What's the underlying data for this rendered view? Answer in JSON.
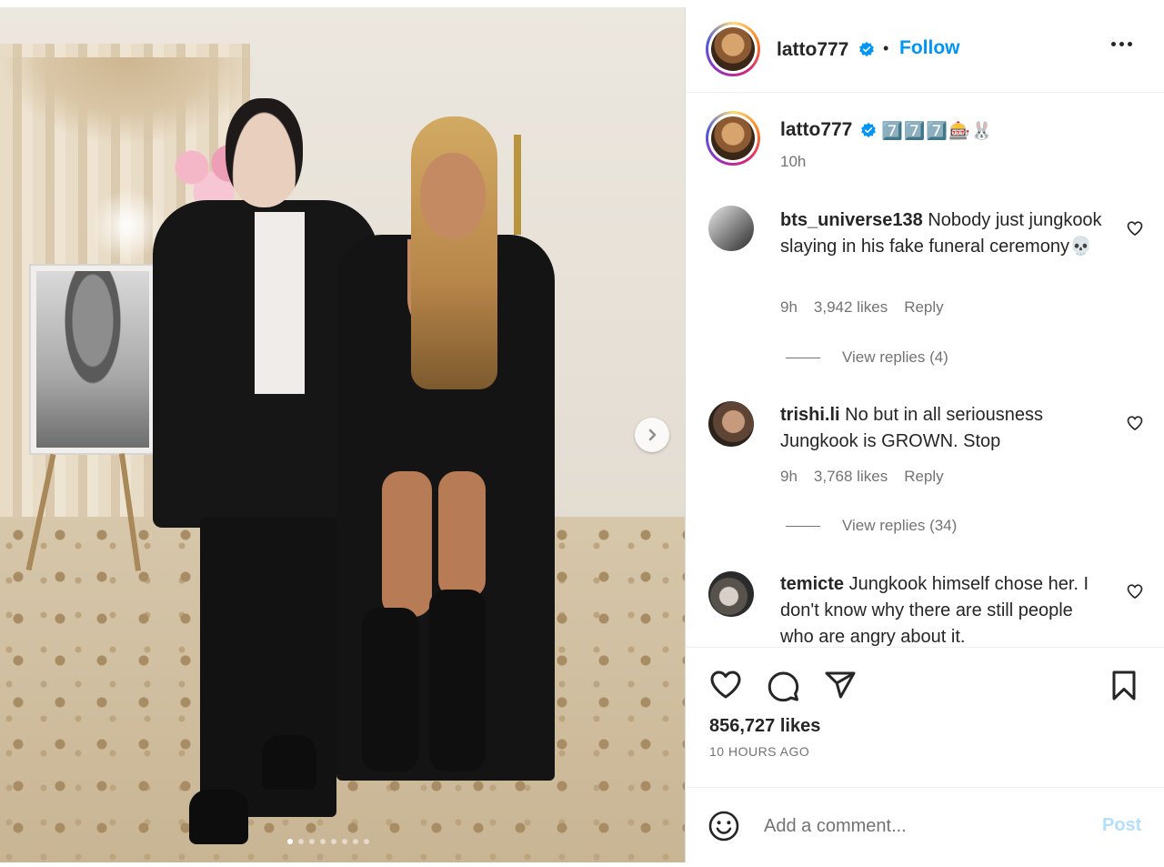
{
  "post": {
    "username": "latto777",
    "follow_separator": "•",
    "follow_label": "Follow",
    "caption": {
      "username": "latto777",
      "text": "7️⃣7️⃣7️⃣🎰🐰",
      "time": "10h"
    },
    "carousel": {
      "slides": 8,
      "active_index": 0
    }
  },
  "comments": [
    {
      "username": "bts_universe138",
      "text": "Nobody just jungkook slaying in his fake funeral ceremony💀",
      "time": "9h",
      "likes": "3,942 likes",
      "reply_label": "Reply",
      "view_replies": "View replies (4)"
    },
    {
      "username": "trishi.li",
      "text": "No but in all seriousness Jungkook is GROWN. Stop",
      "time": "9h",
      "likes": "3,768 likes",
      "reply_label": "Reply",
      "view_replies": "View replies (34)"
    },
    {
      "username": "temicte",
      "text": "Jungkook himself chose her. I don't know why there are still people who are angry about it.",
      "time": "",
      "likes": "",
      "reply_label": "",
      "view_replies": ""
    }
  ],
  "engagement": {
    "likes": "856,727 likes",
    "time_ago": "10 HOURS AGO"
  },
  "comment_box": {
    "placeholder": "Add a comment...",
    "post_label": "Post"
  },
  "icons": {
    "verified": "verified-badge-icon",
    "more": "more-options-icon",
    "like": "heart-icon",
    "comment": "comment-bubble-icon",
    "share": "paper-plane-icon",
    "save": "bookmark-icon",
    "emoji": "smiley-icon",
    "next": "chevron-right-icon"
  },
  "colors": {
    "accent": "#0095f6",
    "verified": "#0095f6",
    "post_disabled": "#b2dffc",
    "secondary_text": "#737373"
  }
}
